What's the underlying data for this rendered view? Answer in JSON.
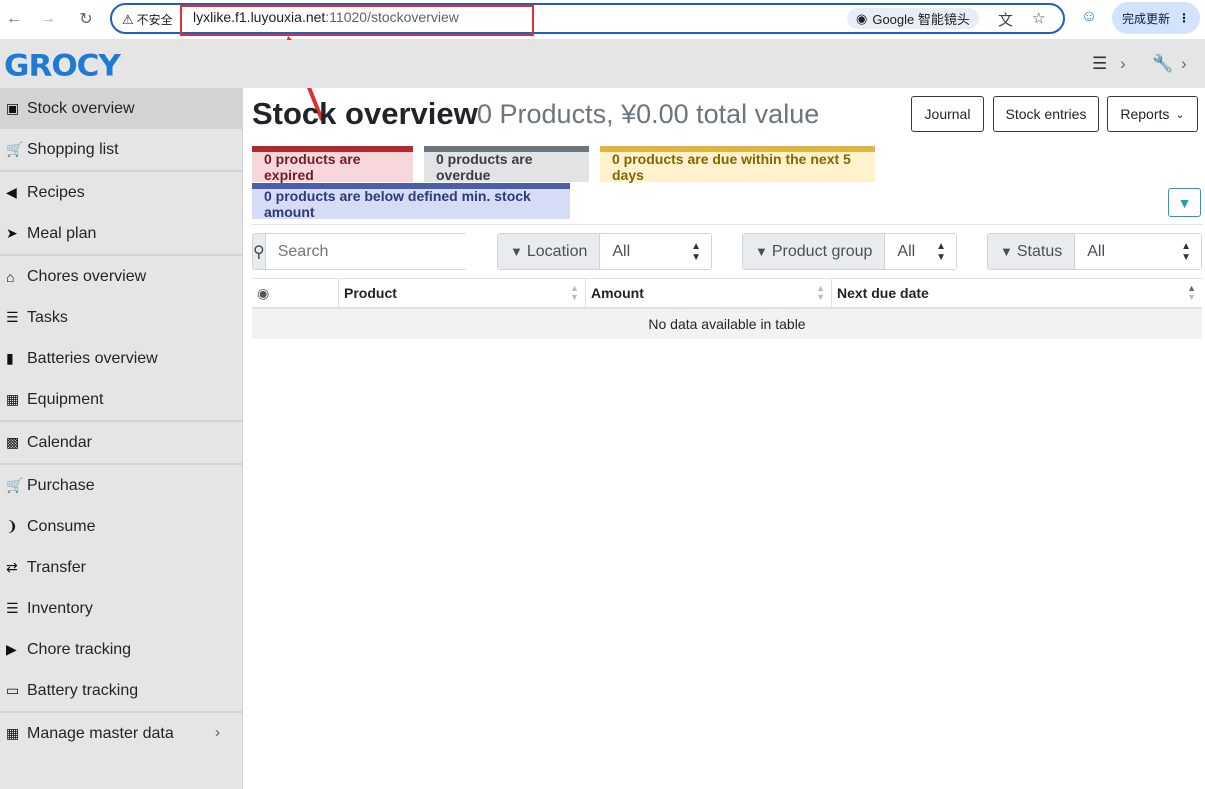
{
  "browser": {
    "insecure_label": "不安全",
    "url_host": "lyxlike.f1.luyouxia.net",
    "url_rest": ":11020/stockoverview",
    "lens_label": "Google 智能镜头",
    "update_label": "完成更新"
  },
  "app": {
    "logo": "GROCY"
  },
  "sidebar": {
    "items": [
      {
        "label": "Stock overview",
        "icon": "box-icon"
      },
      {
        "label": "Shopping list",
        "icon": "cart-icon"
      },
      {
        "label": "Recipes",
        "icon": "pizza-icon"
      },
      {
        "label": "Meal plan",
        "icon": "paper-plane-icon"
      },
      {
        "label": "Chores overview",
        "icon": "home-icon"
      },
      {
        "label": "Tasks",
        "icon": "tasks-icon"
      },
      {
        "label": "Batteries overview",
        "icon": "battery-icon"
      },
      {
        "label": "Equipment",
        "icon": "toolbox-icon"
      },
      {
        "label": "Calendar",
        "icon": "calendar-icon"
      },
      {
        "label": "Purchase",
        "icon": "cart-plus-icon"
      },
      {
        "label": "Consume",
        "icon": "utensils-icon"
      },
      {
        "label": "Transfer",
        "icon": "exchange-icon"
      },
      {
        "label": "Inventory",
        "icon": "list-icon"
      },
      {
        "label": "Chore tracking",
        "icon": "play-icon"
      },
      {
        "label": "Battery tracking",
        "icon": "car-battery-icon"
      },
      {
        "label": "Manage master data",
        "icon": "table-icon"
      }
    ]
  },
  "main": {
    "title": "Stock overview",
    "subtitle": "0 Products, ¥0.00 total value",
    "buttons": {
      "journal": "Journal",
      "stock_entries": "Stock entries",
      "reports": "Reports"
    },
    "status": {
      "expired": "0 products are expired",
      "overdue": "0 products are overdue",
      "due_soon": "0 products are due within the next 5 days",
      "below_min": "0 products are below defined min. stock amount"
    },
    "search": {
      "placeholder": "Search"
    },
    "filters": {
      "location": {
        "label": "Location",
        "value": "All"
      },
      "product_group": {
        "label": "Product group",
        "value": "All"
      },
      "status": {
        "label": "Status",
        "value": "All"
      }
    },
    "table": {
      "columns": [
        "Product",
        "Amount",
        "Next due date"
      ],
      "empty_text": "No data available in table"
    }
  }
}
